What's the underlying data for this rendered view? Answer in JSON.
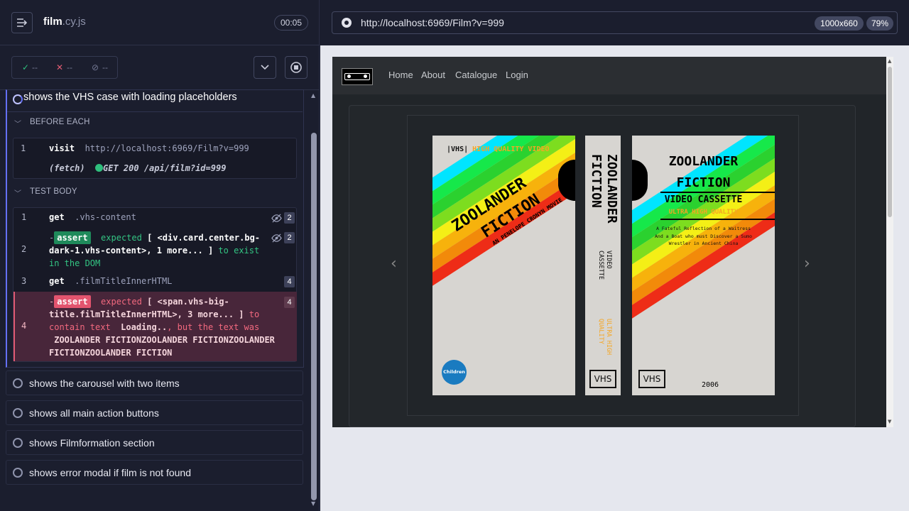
{
  "runner": {
    "spec_name": "film",
    "spec_ext": ".cy.js",
    "duration": "00:05",
    "passed": "--",
    "failed": "--",
    "pending": "--",
    "current_test": "shows the VHS case with loading placeholders",
    "before_each_label": "BEFORE EACH",
    "test_body_label": "TEST BODY",
    "before_each": {
      "line": "1",
      "command": "visit",
      "url": "http://localhost:6969/Film?v=999",
      "fetch_label": "(fetch)",
      "fetch_text": "GET 200 /api/film?id=999"
    },
    "commands": [
      {
        "line": "1",
        "name": "get",
        "arg": ".vhs-content",
        "badge": "2"
      },
      {
        "line": "2",
        "assert_label": "assert",
        "expected": "expected",
        "l1": "[ <div.card.center.bg-",
        "l2a": "dark-1.vhs-content>, 1 more... ]",
        "l2b": "to exist",
        "l3": "in the DOM",
        "badge": "2"
      },
      {
        "line": "3",
        "name": "get",
        "arg": ".filmTitleInnerHTML",
        "badge": "4"
      },
      {
        "line": "4",
        "assert_label": "assert",
        "expected": "expected",
        "l1": "[ <span.vhs-big-",
        "l2a": "title.filmTitleInnerHTML>, 3 more... ]",
        "l2b": "to",
        "l3a": "contain text",
        "l3b": "Loading..",
        "l3c": ", but the text was",
        "l4": "ZOOLANDER FICTIONZOOLANDER FICTIONZOOLANDER",
        "l5": "FICTIONZOOLANDER FICTION",
        "badge": "4"
      }
    ],
    "other_tests": [
      "shows the carousel with two items",
      "shows all main action buttons",
      "shows Filmformation section",
      "shows error modal if film is not found"
    ]
  },
  "browser": {
    "url": "http://localhost:6969/Film?v=999",
    "viewport": "1000x660",
    "zoom": "79%"
  },
  "site": {
    "nav": [
      "Home",
      "About",
      "Catalogue",
      "Login"
    ],
    "vhs": {
      "front_vhs": "VHS",
      "front_tagline": "HIGH QUALITY VIDEO",
      "title_1": "ZOOLANDER",
      "title_2": "FICTION",
      "subtitle": "AN PENELOPE CRONYN MOVIE",
      "rating": "Children",
      "spine_title_1": "ZOOLANDER",
      "spine_title_2": "FICTION",
      "spine_format_1": "VIDEO",
      "spine_format_2": "CASSETTE",
      "spine_quality_1": "ULTRA HIGH",
      "spine_quality_2": "QUALITY",
      "spine_logo": "VHS",
      "back_title_1": "ZOOLANDER",
      "back_title_2": "FICTION",
      "back_format": "VIDEO CASSETTE",
      "back_quality": "ULTRA HIGH QUALITY",
      "desc_1": "A Fateful Reflection of a Waitress",
      "desc_2": "And a Boat who must Discover a Sumo",
      "desc_3": "Wrestler in Ancient China",
      "back_logo": "VHS",
      "year": "2006"
    }
  },
  "colors": {
    "accent": "#6470f3",
    "pass": "#33c583",
    "fail": "#f3697f",
    "vhs_orange": "#f5a623"
  }
}
